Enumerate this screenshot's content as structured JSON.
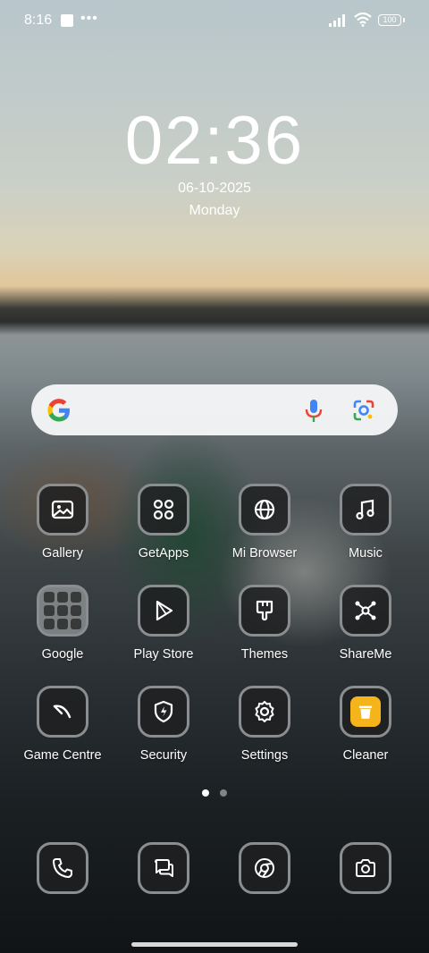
{
  "status_bar": {
    "time": "8:16",
    "battery": "100"
  },
  "clock": {
    "time": "02:36",
    "date": "06-10-2025",
    "day": "Monday"
  },
  "search": {
    "icons": [
      "google-g-icon",
      "mic-icon",
      "lens-icon"
    ]
  },
  "apps": [
    {
      "label": "Gallery",
      "icon": "gallery-icon"
    },
    {
      "label": "GetApps",
      "icon": "getapps-icon"
    },
    {
      "label": "Mi Browser",
      "icon": "globe-icon"
    },
    {
      "label": "Music",
      "icon": "music-note-icon"
    },
    {
      "label": "Google",
      "icon": "folder-icon"
    },
    {
      "label": "Play Store",
      "icon": "play-icon"
    },
    {
      "label": "Themes",
      "icon": "brush-icon"
    },
    {
      "label": "ShareMe",
      "icon": "share-network-icon"
    },
    {
      "label": "Game Centre",
      "icon": "game-icon"
    },
    {
      "label": "Security",
      "icon": "shield-bolt-icon"
    },
    {
      "label": "Settings",
      "icon": "gear-icon"
    },
    {
      "label": "Cleaner",
      "icon": "trash-icon"
    }
  ],
  "page_indicator": {
    "count": 2,
    "active": 1
  },
  "dock": [
    {
      "icon": "phone-icon"
    },
    {
      "icon": "messages-icon"
    },
    {
      "icon": "chrome-icon"
    },
    {
      "icon": "camera-icon"
    }
  ],
  "colors": {
    "cleaner_accent": "#f5b51a",
    "icon_border": "#8a8e90"
  }
}
